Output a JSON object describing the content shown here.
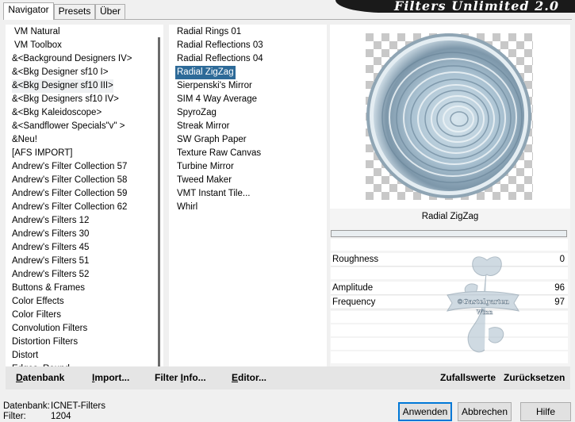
{
  "tabs": [
    "Navigator",
    "Presets",
    "Über"
  ],
  "banner": "Filters Unlimited 2.0",
  "categories": [
    "VM Natural",
    "VM Toolbox",
    "&<Background Designers IV>",
    "&<Bkg Designer sf10 I>",
    "&<Bkg Designer sf10 III>",
    "&<Bkg Designers sf10 IV>",
    "&<Bkg Kaleidoscope>",
    "&<Sandflower Specials\"v\" >",
    "&Neu!",
    "[AFS IMPORT]",
    "Andrew's Filter Collection 57",
    "Andrew's Filter Collection 58",
    "Andrew's Filter Collection 59",
    "Andrew's Filter Collection 62",
    "Andrew's Filters 12",
    "Andrew's Filters 30",
    "Andrew's Filters 45",
    "Andrew's Filters 51",
    "Andrew's Filters 52",
    "Buttons & Frames",
    "Color Effects",
    "Color Filters",
    "Convolution Filters",
    "Distortion Filters",
    "Distort",
    "Edges, Round"
  ],
  "selected_category": "&<Bkg Designer sf10 III>",
  "filters": [
    "Radial  Rings 01",
    "Radial Reflections 03",
    "Radial Reflections 04",
    "Radial ZigZag",
    "Sierpenski's Mirror",
    "SIM 4 Way Average",
    "SpyroZag",
    "Streak Mirror",
    "SW Graph Paper",
    "Texture Raw Canvas",
    "Turbine Mirror",
    "Tweed Maker",
    "VMT Instant Tile...",
    "Whirl"
  ],
  "selected_filter": "Radial ZigZag",
  "preview": {
    "filter_label": "Radial ZigZag",
    "params": [
      {
        "name": "Roughness",
        "value": "0"
      },
      {
        "name": "Amplitude",
        "value": "96"
      },
      {
        "name": "Frequency",
        "value": "97"
      }
    ]
  },
  "watermark": {
    "line1": "©Gastelgarten",
    "line2": "Winn"
  },
  "toolbar": {
    "database": {
      "u": "D",
      "rest": "atenbank"
    },
    "import": {
      "u": "I",
      "rest": "mport..."
    },
    "filter_info": {
      "pre": "Filter ",
      "u": "I",
      "rest": "nfo..."
    },
    "editor": {
      "u": "E",
      "rest": "ditor..."
    },
    "random": "Zufallswerte",
    "reset": "Zurücksetzen"
  },
  "status": {
    "db_label": "Datenbank:",
    "db_value": "ICNET-Filters",
    "filter_label": "Filter:",
    "filter_value": "1204"
  },
  "buttons": {
    "ok": "Anwenden",
    "cancel": "Abbrechen",
    "help": "Hilfe"
  },
  "colors": {
    "selection": "#2d6a98",
    "default_button_border": "#0078d7"
  }
}
